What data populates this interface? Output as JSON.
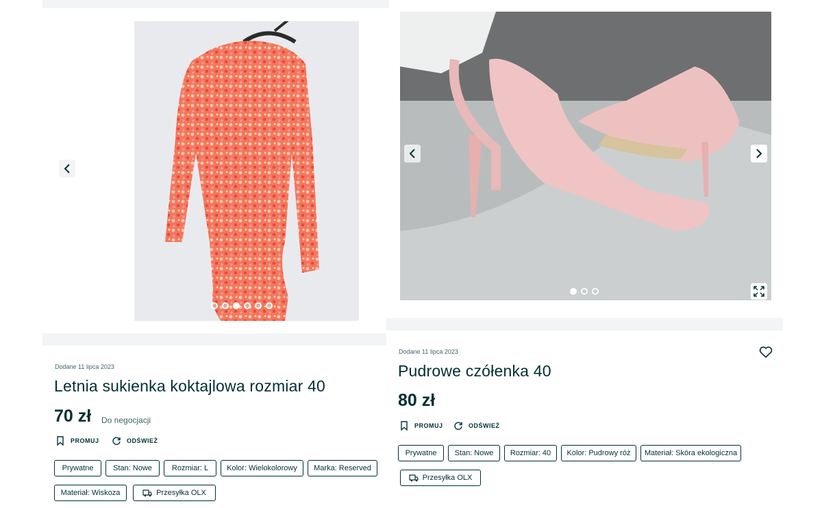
{
  "left_listing": {
    "date": "Dodane 11 lipca 2023",
    "title": "Letnia sukienka koktajlowa rozmiar 40",
    "price": "70 zł",
    "negotiable": "Do negocjacji",
    "promote_label": "PROMUJ",
    "refresh_label": "ODŚWIEŻ",
    "tags": [
      "Prywatne",
      "Stan: Nowe",
      "Rozmiar: L",
      "Kolor: Wielokolorowy",
      "Marka: Reserved",
      "Materiał: Wiskoza"
    ],
    "shipping_tag": "Przesyłka OLX",
    "photo_count": 6,
    "active_photo": 3
  },
  "right_listing": {
    "date": "Dodane 11 lipca 2023",
    "title": "Pudrowe czółenka 40",
    "price": "80 zł",
    "promote_label": "PROMUJ",
    "refresh_label": "ODŚWIEŻ",
    "tags": [
      "Prywatne",
      "Stan: Nowe",
      "Rozmiar: 40",
      "Kolor: Pudrowy róż",
      "Materiał: Skóra ekologiczna"
    ],
    "shipping_tag": "Przesyłka OLX",
    "photo_count": 3,
    "active_photo": 1
  },
  "icons": {
    "prev": "chevron-left-icon",
    "next": "chevron-right-icon",
    "fullscreen": "expand-icon",
    "favorite": "heart-icon",
    "promote": "bookmark-icon",
    "refresh": "refresh-icon",
    "shipping": "truck-icon"
  },
  "colors": {
    "text": "#002f34",
    "muted": "#406367",
    "panel": "#f2f4f5"
  }
}
